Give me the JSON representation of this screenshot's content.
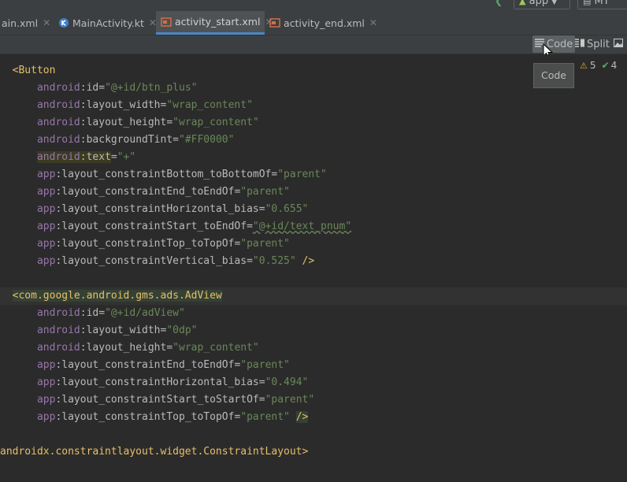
{
  "toolbar_top": {
    "app_label": "app",
    "device_label": "MY"
  },
  "tabs": [
    {
      "label": "ain.xml"
    },
    {
      "label": "MainActivity.kt"
    },
    {
      "label": "activity_start.xml"
    },
    {
      "label": "activity_end.xml"
    }
  ],
  "view_modes": {
    "code": "Code",
    "split": "Split"
  },
  "tooltip": "Code",
  "inspections": {
    "warnings": "5",
    "ok": "4"
  },
  "code": [
    {
      "tag": "<Button"
    },
    {
      "ns": "android",
      "attr": "id",
      "val": "\"@+id/btn_plus\""
    },
    {
      "ns": "android",
      "attr": "layout_width",
      "val": "\"wrap_content\""
    },
    {
      "ns": "android",
      "attr": "layout_height",
      "val": "\"wrap_content\""
    },
    {
      "ns": "android",
      "attr": "backgroundTint",
      "val": "\"#FF0000\""
    },
    {
      "ns": "android",
      "attr": "text",
      "val": "\"+\""
    },
    {
      "ns": "app",
      "attr": "layout_constraintBottom_toBottomOf",
      "val": "\"parent\""
    },
    {
      "ns": "app",
      "attr": "layout_constraintEnd_toEndOf",
      "val": "\"parent\""
    },
    {
      "ns": "app",
      "attr": "layout_constraintHorizontal_bias",
      "val": "\"0.655\""
    },
    {
      "ns": "app",
      "attr": "layout_constraintStart_toEndOf",
      "val": "\"@+id/text_pnum\""
    },
    {
      "ns": "app",
      "attr": "layout_constraintTop_toTopOf",
      "val": "\"parent\""
    },
    {
      "ns": "app",
      "attr": "layout_constraintVertical_bias",
      "val": "\"0.525\"",
      "end": "/>"
    },
    {
      "blank": ""
    },
    {
      "lt": "<",
      "tag": "com.google.android.gms.ads.AdView"
    },
    {
      "ns": "android",
      "attr": "id",
      "val": "\"@+id/adView\""
    },
    {
      "ns": "android",
      "attr": "layout_width",
      "val": "\"0dp\""
    },
    {
      "ns": "android",
      "attr": "layout_height",
      "val": "\"wrap_content\""
    },
    {
      "ns": "app",
      "attr": "layout_constraintEnd_toEndOf",
      "val": "\"parent\""
    },
    {
      "ns": "app",
      "attr": "layout_constraintHorizontal_bias",
      "val": "\"0.494\""
    },
    {
      "ns": "app",
      "attr": "layout_constraintStart_toStartOf",
      "val": "\"parent\""
    },
    {
      "ns": "app",
      "attr": "layout_constraintTop_toTopOf",
      "val": "\"parent\"",
      "end": "/>"
    },
    {
      "blank": ""
    },
    {
      "tag": "androidx.constraintlayout.widget.ConstraintLayout>"
    }
  ]
}
